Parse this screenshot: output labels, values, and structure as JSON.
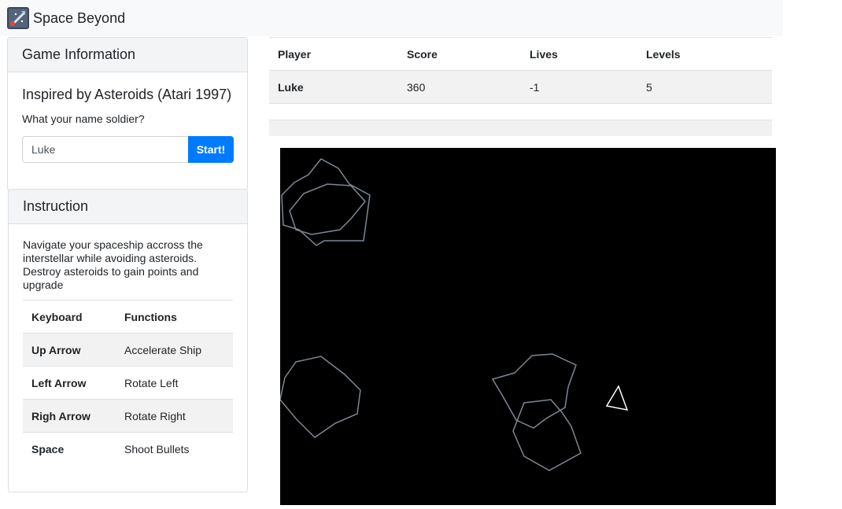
{
  "navbar": {
    "brand": "Space Beyond",
    "logo_icon": "spaceship-logo-icon"
  },
  "game_info": {
    "title": "Game Information",
    "inspired": "Inspired by Asteroids (Atari 1997)",
    "name_question": "What your name soldier?",
    "name_value": "Luke",
    "start_label": "Start!"
  },
  "instruction": {
    "title": "Instruction",
    "text": "Navigate your spaceship accross the interstellar while avoiding asteroids. Destroy asteroids to gain points and upgrade",
    "headers": [
      "Keyboard",
      "Functions"
    ],
    "rows": [
      {
        "key": "Up Arrow",
        "function": "Accelerate Ship"
      },
      {
        "key": "Left Arrow",
        "function": "Rotate Left"
      },
      {
        "key": "Righ Arrow",
        "function": "Rotate Right"
      },
      {
        "key": "Space",
        "function": "Shoot Bullets"
      }
    ]
  },
  "scoreboard": {
    "headers": [
      "Player",
      "Score",
      "Lives",
      "Levels"
    ],
    "row": {
      "player": "Luke",
      "score": "360",
      "lives": "-1",
      "levels": "5"
    }
  },
  "game": {
    "background_color": "#000000",
    "asteroid_color": "#7d8893",
    "ship_color": "#ffffff"
  }
}
